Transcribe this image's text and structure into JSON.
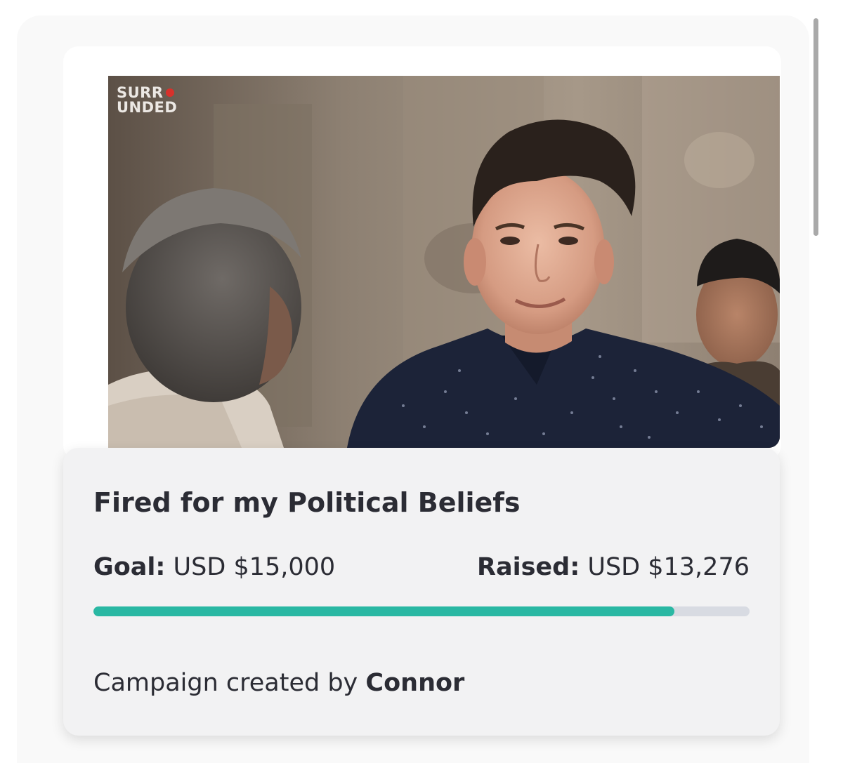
{
  "video": {
    "logo_line1": "SURR",
    "logo_line2": "UNDED"
  },
  "campaign": {
    "title": "Fired for my Political Beliefs",
    "goal_label": "Goal:",
    "goal_value": "USD $15,000",
    "raised_label": "Raised:",
    "raised_value": "USD $13,276",
    "progress_fraction": 0.885,
    "creator_prefix": "Campaign created by",
    "creator_name": "Connor"
  },
  "colors": {
    "progress_fill": "#2ab8a3",
    "progress_track": "#d8dbe2",
    "logo_dot": "#d8312b",
    "text": "#2b2c34"
  }
}
